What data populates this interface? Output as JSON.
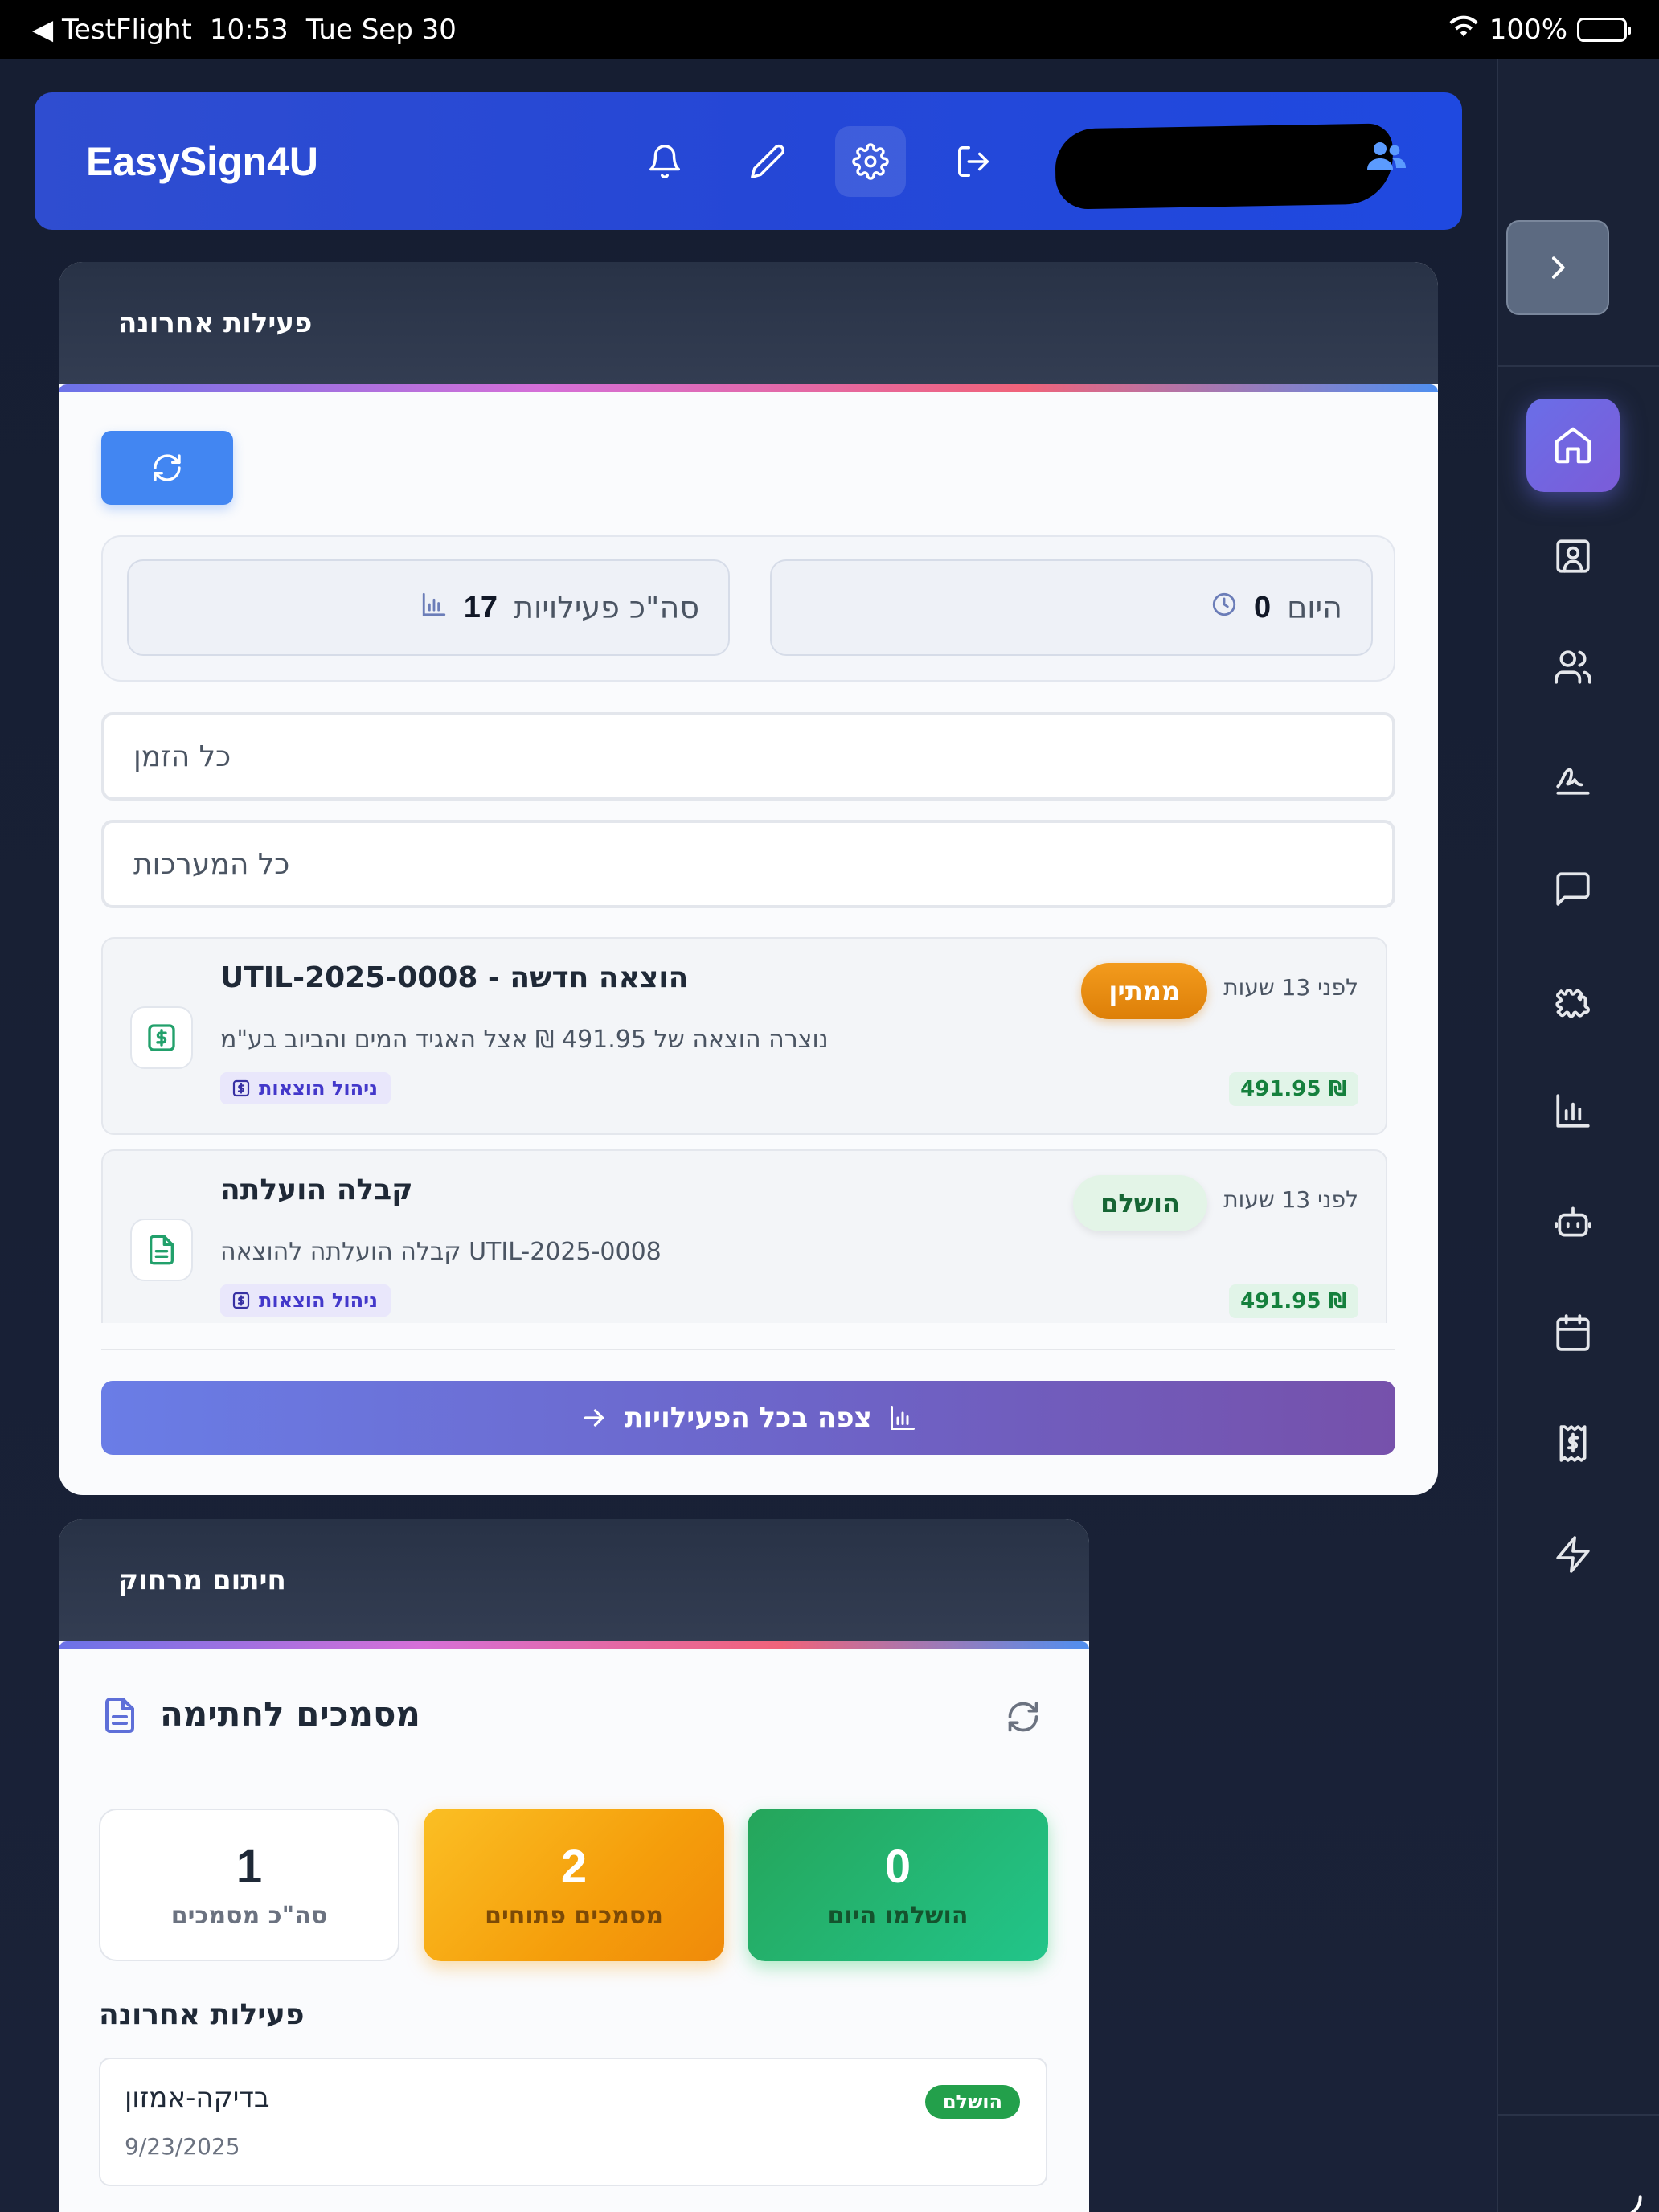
{
  "status_bar": {
    "back_app": "◀ TestFlight",
    "time": "10:53",
    "date": "Tue Sep 30",
    "battery": "100%"
  },
  "header": {
    "brand": "EasySign4U",
    "icons": [
      "bell-icon",
      "pen-icon",
      "gear-icon",
      "logout-icon"
    ],
    "user_icon": "users-icon"
  },
  "sidebar": {
    "toggle_icon": "chevron-right-icon",
    "items": [
      {
        "icon": "home-icon",
        "active": true
      },
      {
        "icon": "contact-card-icon",
        "active": false
      },
      {
        "icon": "users-icon",
        "active": false
      },
      {
        "icon": "signature-icon",
        "active": false
      },
      {
        "icon": "chat-icon",
        "active": false
      },
      {
        "icon": "puzzle-icon",
        "active": false
      },
      {
        "icon": "bar-chart-icon",
        "active": false
      },
      {
        "icon": "robot-icon",
        "active": false
      },
      {
        "icon": "calendar-icon",
        "active": false
      },
      {
        "icon": "receipt-icon",
        "active": false
      },
      {
        "icon": "lightning-icon",
        "active": false
      }
    ]
  },
  "recent_activity": {
    "title": "פעילות אחרונה",
    "stats": {
      "total_label": "סה\"כ פעילויות",
      "total_value": "17",
      "today_label": "היום",
      "today_value": "0"
    },
    "filters": {
      "time": "כל הזמן",
      "systems": "כל המערכות"
    },
    "items": [
      {
        "title": "UTIL-2025-0008 - הוצאה חדשה",
        "description": "נוצרה הוצאה של 491.95 ₪ אצל האגיד המים והביוב בע\"מ",
        "tag": "ניהול הוצאות",
        "time": "לפני 13 שעות",
        "status": "ממתין",
        "amount": "491.95 ₪"
      },
      {
        "title": "קבלה הועלתה",
        "description": "קבלה הועלתה להוצאה UTIL-2025-0008",
        "tag": "ניהול הוצאות",
        "time": "לפני 13 שעות",
        "status": "הושלם",
        "amount": "491.95 ₪"
      }
    ],
    "view_all": "צפה בכל הפעילויות"
  },
  "remote_signing": {
    "title": "חיתום מרחוק",
    "docs_title": "מסמכים לחתימה",
    "stats": [
      {
        "value": "1",
        "label": "סה\"כ מסמכים"
      },
      {
        "value": "2",
        "label": "מסמכים פתוחים"
      },
      {
        "value": "0",
        "label": "הושלמו היום"
      }
    ],
    "recent_title": "פעילות אחרונה",
    "recent": {
      "name": "בדיקה-אמזון",
      "date": "9/23/2025",
      "status": "הושלם"
    }
  }
}
